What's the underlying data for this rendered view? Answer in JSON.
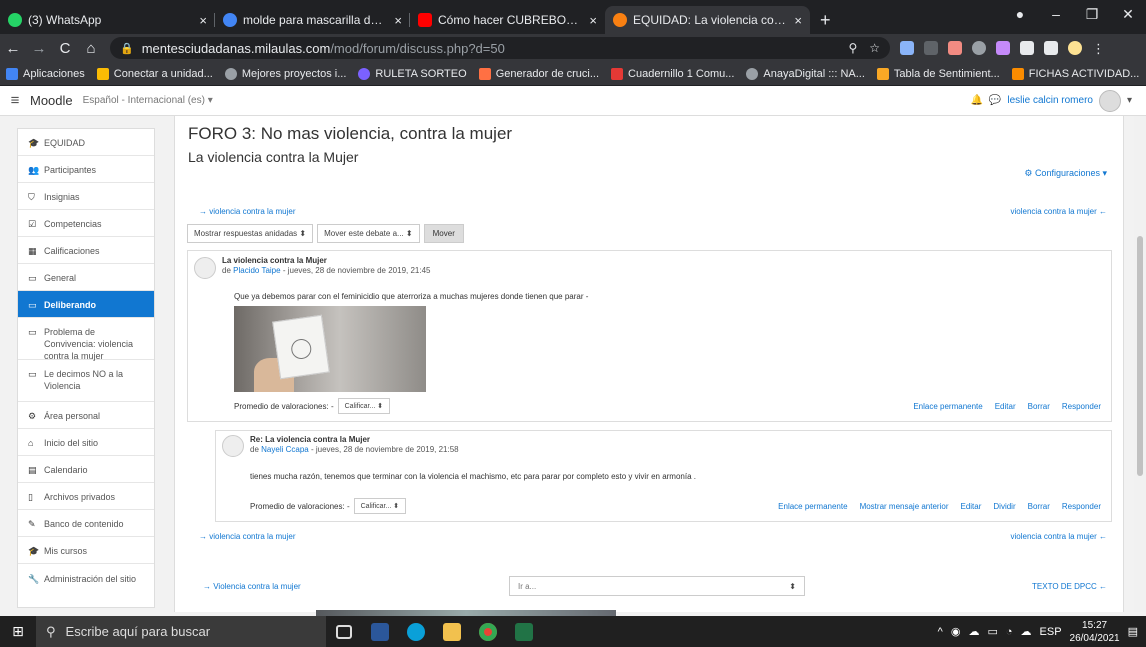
{
  "browser": {
    "tabs": [
      {
        "title": "(3) WhatsApp",
        "close": "×",
        "color": "#25d366"
      },
      {
        "title": "molde para mascarilla de niños - ",
        "close": "×",
        "color": "#4285f4"
      },
      {
        "title": "Cómo hacer CUBREBOCAS para",
        "close": "×",
        "color": "#ff0000"
      },
      {
        "title": "EQUIDAD: La violencia contra la",
        "close": "×",
        "color": "#f98012"
      }
    ],
    "new_tab": "+",
    "url_host": "mentesciudadanas.milaulas.com",
    "url_path": "/mod/forum/discuss.php?d=50",
    "bookmarks": [
      {
        "label": "Aplicaciones",
        "color": "#4285f4"
      },
      {
        "label": "Conectar a unidad...",
        "color": "#fbbc04"
      },
      {
        "label": "Mejores proyectos i...",
        "color": "#9aa0a6"
      },
      {
        "label": "RULETA SORTEO",
        "color": "#7b61ff"
      },
      {
        "label": "Generador de cruci...",
        "color": "#ff7043"
      },
      {
        "label": "Cuadernillo 1 Comu...",
        "color": "#e53935"
      },
      {
        "label": "AnayaDigital ::: NA...",
        "color": "#9aa0a6"
      },
      {
        "label": "Tabla de Sentimient...",
        "color": "#f9a825"
      },
      {
        "label": "FICHAS ACTIVIDAD...",
        "color": "#fb8c00"
      }
    ],
    "more": "»"
  },
  "moodle": {
    "brand": "Moodle",
    "language": "Español - Internacional (es) ▾",
    "user": "leslie calcin romero"
  },
  "sidebar": [
    {
      "label": "EQUIDAD",
      "icon": "graduation-cap-icon",
      "glyph": "🎓"
    },
    {
      "label": "Participantes",
      "icon": "users-icon",
      "glyph": "👥"
    },
    {
      "label": "Insignias",
      "icon": "shield-icon",
      "glyph": "⛉"
    },
    {
      "label": "Competencias",
      "icon": "check-square-icon",
      "glyph": "☑"
    },
    {
      "label": "Calificaciones",
      "icon": "table-icon",
      "glyph": "▦"
    },
    {
      "label": "General",
      "icon": "folder-icon",
      "glyph": "▭"
    },
    {
      "label": "Deliberando",
      "icon": "folder-icon",
      "glyph": "▭",
      "active": true
    },
    {
      "label": "Problema de Convivencia: violencia contra la mujer",
      "icon": "folder-icon",
      "glyph": "▭"
    },
    {
      "label": "Le decimos NO a la Violencia",
      "icon": "folder-icon",
      "glyph": "▭"
    },
    {
      "label": "Área personal",
      "icon": "dashboard-icon",
      "glyph": "⚙"
    },
    {
      "label": "Inicio del sitio",
      "icon": "home-icon",
      "glyph": "⌂"
    },
    {
      "label": "Calendario",
      "icon": "calendar-icon",
      "glyph": "▤"
    },
    {
      "label": "Archivos privados",
      "icon": "file-icon",
      "glyph": "▯"
    },
    {
      "label": "Banco de contenido",
      "icon": "pencil-icon",
      "glyph": "✎"
    },
    {
      "label": "Mis cursos",
      "icon": "graduation-cap-icon",
      "glyph": "🎓"
    },
    {
      "label": "Administración del sitio",
      "icon": "wrench-icon",
      "glyph": "🔧"
    }
  ],
  "forum": {
    "title": "FORO 3: No mas violencia, contra la mujer",
    "discussion": "La violencia contra la Mujer",
    "settings": "Configuraciones ▾",
    "prev_link": "→ violencia contra la mujer",
    "next_link": "violencia contra la mujer ←",
    "display_mode": "Mostrar respuestas anidadas  ⬍",
    "move_select": "Mover este debate a...  ⬍",
    "move_button": "Mover",
    "posts": [
      {
        "subject": "La violencia contra la Mujer",
        "by_prefix": "de",
        "author": "Placido Taipe",
        "date": "- jueves, 28 de noviembre de 2019, 21:45",
        "body": "Que ya debemos parar con el feminicidio que aterroriza a muchas mujeres donde tienen que parar -",
        "rating_label": "Promedio de valoraciones: -",
        "rating_select": "Calificar...  ⬍",
        "actions": [
          "Enlace permanente",
          "Editar",
          "Borrar",
          "Responder"
        ]
      },
      {
        "subject": "Re: La violencia contra la Mujer",
        "by_prefix": "de",
        "author": "Nayeli Ccapa",
        "date": "- jueves, 28 de noviembre de 2019, 21:58",
        "body": "tienes mucha razón, tenemos que terminar con la violencia el machismo, etc para parar por completo esto y vivir en armonía .",
        "rating_label": "Promedio de valoraciones: -",
        "rating_select": "Calificar...  ⬍",
        "actions": [
          "Enlace permanente",
          "Mostrar mensaje anterior",
          "Editar",
          "Dividir",
          "Borrar",
          "Responder"
        ]
      }
    ],
    "footer_prev": "→ Violencia contra la mujer",
    "jump_placeholder": "Ir a...",
    "footer_next": "TEXTO DE DPCC ←"
  },
  "taskbar": {
    "search_placeholder": "Escribe aquí para buscar",
    "lang": "ESP",
    "time": "15:27",
    "date": "26/04/2021"
  }
}
